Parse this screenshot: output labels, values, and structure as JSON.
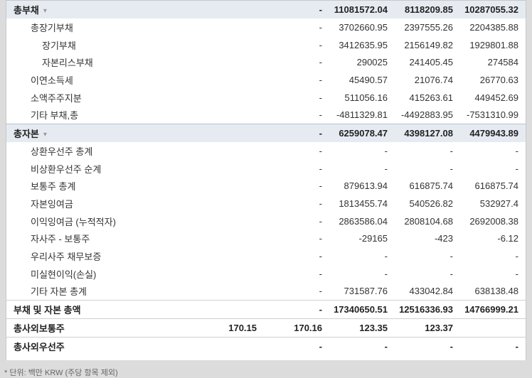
{
  "rows": [
    {
      "label": "총부채",
      "type": "section",
      "chevron": true,
      "v": [
        "-",
        "11081572.04",
        "8118209.85",
        "10287055.32"
      ],
      "v0": ""
    },
    {
      "label": "총장기부채",
      "type": "i1",
      "v": [
        "-",
        "3702660.95",
        "2397555.26",
        "2204385.88"
      ],
      "v0": ""
    },
    {
      "label": "장기부채",
      "type": "i2",
      "v": [
        "-",
        "3412635.95",
        "2156149.82",
        "1929801.88"
      ],
      "v0": ""
    },
    {
      "label": "자본리스부채",
      "type": "i2",
      "v": [
        "-",
        "290025",
        "241405.45",
        "274584"
      ],
      "v0": ""
    },
    {
      "label": "이연소득세",
      "type": "i1",
      "v": [
        "-",
        "45490.57",
        "21076.74",
        "26770.63"
      ],
      "v0": ""
    },
    {
      "label": "소액주주지분",
      "type": "i1",
      "v": [
        "-",
        "511056.16",
        "415263.61",
        "449452.69"
      ],
      "v0": ""
    },
    {
      "label": "기타 부채,총",
      "type": "i1",
      "v": [
        "-",
        "-4811329.81",
        "-4492883.95",
        "-7531310.99"
      ],
      "v0": ""
    },
    {
      "label": "총자본",
      "type": "section",
      "chevron": true,
      "v": [
        "-",
        "6259078.47",
        "4398127.08",
        "4479943.89"
      ],
      "v0": ""
    },
    {
      "label": "상환우선주 총계",
      "type": "i1",
      "v": [
        "-",
        "-",
        "-",
        "-"
      ],
      "v0": ""
    },
    {
      "label": "비상환우선주 순계",
      "type": "i1",
      "v": [
        "-",
        "-",
        "-",
        "-"
      ],
      "v0": ""
    },
    {
      "label": "보통주 총계",
      "type": "i1",
      "v": [
        "-",
        "879613.94",
        "616875.74",
        "616875.74"
      ],
      "v0": ""
    },
    {
      "label": "자본잉여금",
      "type": "i1",
      "v": [
        "-",
        "1813455.74",
        "540526.82",
        "532927.4"
      ],
      "v0": ""
    },
    {
      "label": "이익잉여금 (누적적자)",
      "type": "i1",
      "v": [
        "-",
        "2863586.04",
        "2808104.68",
        "2692008.38"
      ],
      "v0": ""
    },
    {
      "label": "자사주 - 보통주",
      "type": "i1",
      "v": [
        "-",
        "-29165",
        "-423",
        "-6.12"
      ],
      "v0": ""
    },
    {
      "label": "우리사주 채무보증",
      "type": "i1",
      "v": [
        "-",
        "-",
        "-",
        "-"
      ],
      "v0": ""
    },
    {
      "label": "미실현이익(손실)",
      "type": "i1",
      "v": [
        "-",
        "-",
        "-",
        "-"
      ],
      "v0": ""
    },
    {
      "label": "기타 자본 총계",
      "type": "i1",
      "v": [
        "-",
        "731587.76",
        "433042.84",
        "638138.48"
      ],
      "v0": ""
    },
    {
      "label": "부채 및 자본 총액",
      "type": "total",
      "v": [
        "-",
        "17340650.51",
        "12516336.93",
        "14766999.21"
      ],
      "v0": ""
    },
    {
      "label": "총사외보통주",
      "type": "total",
      "v": [
        "170.16",
        "123.35",
        "123.37"
      ],
      "v0": "170.15"
    },
    {
      "label": "총사외우선주",
      "type": "total",
      "v": [
        "-",
        "-",
        "-",
        "-"
      ],
      "v0": ""
    }
  ],
  "footnote": "* 단위: 백만 KRW (주당 항목 제외)"
}
